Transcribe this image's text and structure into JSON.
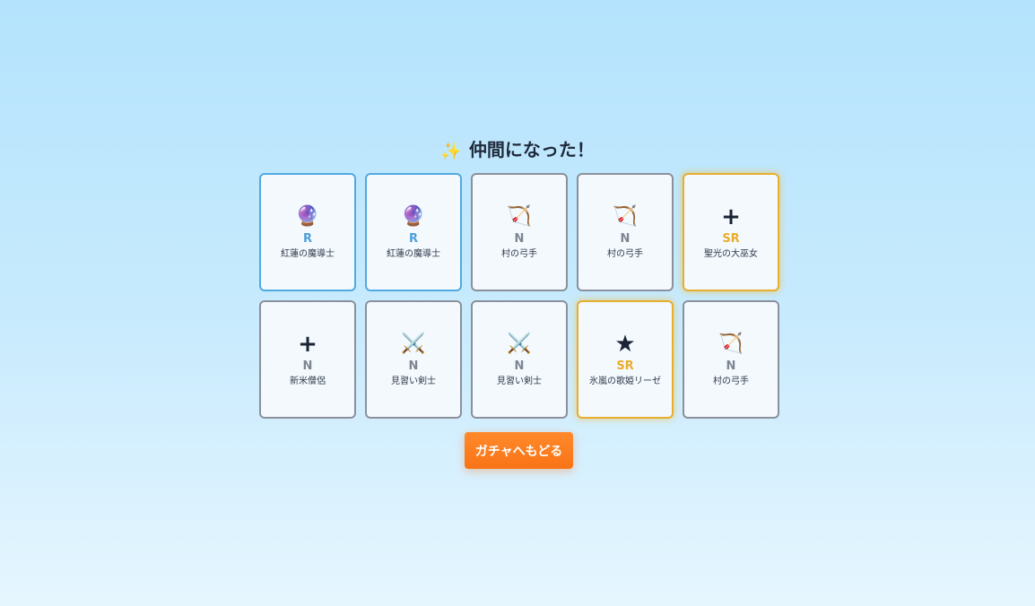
{
  "result": {
    "title_icon": "sparkles-icon",
    "title": "仲間になった！",
    "back_button_label": "ガチャへもどる"
  },
  "cards": [
    {
      "icon": "crystal-ball-icon",
      "glyph": "🔮",
      "rarity": "R",
      "name": "紅蓮の魔導士"
    },
    {
      "icon": "crystal-ball-icon",
      "glyph": "🔮",
      "rarity": "R",
      "name": "紅蓮の魔導士"
    },
    {
      "icon": "bow-and-arrow-icon",
      "glyph": "🏹",
      "rarity": "N",
      "name": "村の弓手"
    },
    {
      "icon": "bow-and-arrow-icon",
      "glyph": "🏹",
      "rarity": "N",
      "name": "村の弓手"
    },
    {
      "icon": "plus-icon",
      "glyph": "+",
      "rarity": "SR",
      "name": "聖光の大巫女"
    },
    {
      "icon": "plus-icon",
      "glyph": "+",
      "rarity": "N",
      "name": "新米僧侶"
    },
    {
      "icon": "crossed-swords-icon",
      "glyph": "⚔️",
      "rarity": "N",
      "name": "見習い剣士"
    },
    {
      "icon": "crossed-swords-icon",
      "glyph": "⚔️",
      "rarity": "N",
      "name": "見習い剣士"
    },
    {
      "icon": "star-icon",
      "glyph": "★",
      "rarity": "SR",
      "name": "氷嵐の歌姫リーゼ"
    },
    {
      "icon": "bow-and-arrow-icon",
      "glyph": "🏹",
      "rarity": "N",
      "name": "村の弓手"
    }
  ],
  "colors": {
    "rarity_N": "#8a919c",
    "rarity_R": "#52a9e0",
    "rarity_SR": "#e8ad2e",
    "button": "#f97316",
    "background_top": "#b4e3fd",
    "background_bottom": "#e6f6ff"
  }
}
